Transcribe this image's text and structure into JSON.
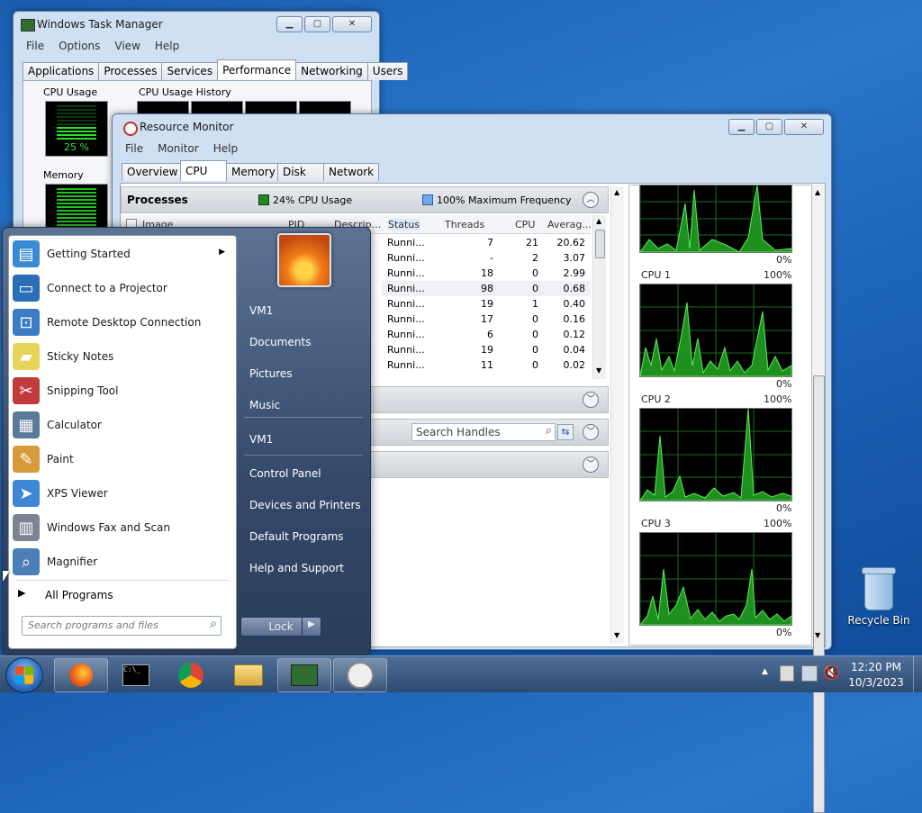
{
  "task_manager": {
    "title": "Windows Task Manager",
    "menu": [
      "File",
      "Options",
      "View",
      "Help"
    ],
    "tabs": [
      "Applications",
      "Processes",
      "Services",
      "Performance",
      "Networking",
      "Users"
    ],
    "active_tab": "Performance",
    "cpu_usage_label": "CPU Usage",
    "cpu_usage_value": "25 %",
    "cpu_history_label": "CPU Usage History",
    "memory_label": "Memory"
  },
  "resource_monitor": {
    "title": "Resource Monitor",
    "menu": [
      "File",
      "Monitor",
      "Help"
    ],
    "tabs": [
      "Overview",
      "CPU",
      "Memory",
      "Disk",
      "Network"
    ],
    "active_tab": "CPU",
    "processes_title": "Processes",
    "cpu_usage_text": "24% CPU Usage",
    "max_freq_text": "100% Maximum Frequency",
    "columns": [
      "Image",
      "PID",
      "Descrip...",
      "Status",
      "Threads",
      "CPU",
      "Averag..."
    ],
    "rows": [
      {
        "status": "Runni...",
        "threads": "7",
        "cpu": "21",
        "avg": "20.62"
      },
      {
        "status": "Runni...",
        "threads": "-",
        "cpu": "2",
        "avg": "3.07"
      },
      {
        "status": "Runni...",
        "threads": "18",
        "cpu": "0",
        "avg": "2.99"
      },
      {
        "status": "Runni...",
        "threads": "98",
        "cpu": "0",
        "avg": "0.68"
      },
      {
        "status": "Runni...",
        "threads": "19",
        "cpu": "1",
        "avg": "0.40"
      },
      {
        "status": "Runni...",
        "threads": "17",
        "cpu": "0",
        "avg": "0.16"
      },
      {
        "status": "Runni...",
        "threads": "6",
        "cpu": "0",
        "avg": "0.12"
      },
      {
        "status": "Runni...",
        "threads": "19",
        "cpu": "0",
        "avg": "0.04"
      },
      {
        "status": "Runni...",
        "threads": "11",
        "cpu": "0",
        "avg": "0.02"
      }
    ],
    "search_handles_placeholder": "Search Handles",
    "cpu_graphs": [
      {
        "label": "",
        "max": "",
        "min": "0%"
      },
      {
        "label": "CPU 1",
        "max": "100%",
        "min": "0%"
      },
      {
        "label": "CPU 2",
        "max": "100%",
        "min": "0%"
      },
      {
        "label": "CPU 3",
        "max": "100%",
        "min": "0%"
      }
    ]
  },
  "start_menu": {
    "programs": [
      {
        "label": "Getting Started",
        "icon": "getting-started-icon",
        "color": "#3a8ad1",
        "glyph": "▤"
      },
      {
        "label": "Connect to a Projector",
        "icon": "projector-icon",
        "color": "#2a6fb8",
        "glyph": "▭"
      },
      {
        "label": "Remote Desktop Connection",
        "icon": "remote-desktop-icon",
        "color": "#3b7cc4",
        "glyph": "⊡"
      },
      {
        "label": "Sticky Notes",
        "icon": "sticky-notes-icon",
        "color": "#e7d45a",
        "glyph": "▰"
      },
      {
        "label": "Snipping Tool",
        "icon": "scissors-icon",
        "color": "#c23b3b",
        "glyph": "✂"
      },
      {
        "label": "Calculator",
        "icon": "calculator-icon",
        "color": "#5a7a9a",
        "glyph": "▦"
      },
      {
        "label": "Paint",
        "icon": "paint-icon",
        "color": "#d69a3a",
        "glyph": "✎"
      },
      {
        "label": "XPS Viewer",
        "icon": "xps-viewer-icon",
        "color": "#3f86d6",
        "glyph": "➤"
      },
      {
        "label": "Windows Fax and Scan",
        "icon": "fax-icon",
        "color": "#7b8592",
        "glyph": "▥"
      },
      {
        "label": "Magnifier",
        "icon": "magnifier-icon",
        "color": "#4c7fb8",
        "glyph": "⌕"
      }
    ],
    "all_programs": "All Programs",
    "search_placeholder": "Search programs and files",
    "right_items": [
      {
        "label": "VM1"
      },
      {
        "label": "Documents"
      },
      {
        "label": "Pictures"
      },
      {
        "label": "Music"
      },
      {
        "label": "VM1"
      },
      {
        "label": "Control Panel"
      },
      {
        "label": "Devices and Printers"
      },
      {
        "label": "Default Programs"
      },
      {
        "label": "Help and Support"
      }
    ],
    "lock_label": "Lock"
  },
  "desktop": {
    "recycle_bin_label": "Recycle Bin"
  },
  "taskbar": {
    "time": "12:20 PM",
    "date": "10/3/2023",
    "apps": [
      "firefox-icon",
      "command-prompt-icon",
      "chrome-icon",
      "file-explorer-icon",
      "task-manager-icon",
      "resource-monitor-icon"
    ]
  }
}
